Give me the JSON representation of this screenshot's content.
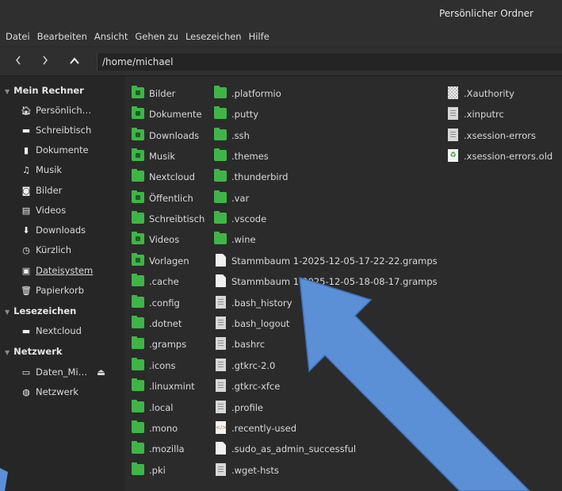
{
  "window": {
    "title": "Persönlicher Ordner"
  },
  "menu": [
    "Datei",
    "Bearbeiten",
    "Ansicht",
    "Gehen zu",
    "Lesezeichen",
    "Hilfe"
  ],
  "toolbar": {
    "back_icon": "chevron-left-icon",
    "forward_icon": "chevron-right-icon",
    "up_icon": "chevron-up-icon",
    "path": "/home/michael"
  },
  "sidebar": {
    "sections": [
      {
        "header": "Mein Rechner",
        "items": [
          {
            "label": "Persönlich…",
            "icon": "home-icon"
          },
          {
            "label": "Schreibtisch",
            "icon": "desktop-icon"
          },
          {
            "label": "Dokumente",
            "icon": "document-icon"
          },
          {
            "label": "Musik",
            "icon": "music-icon"
          },
          {
            "label": "Bilder",
            "icon": "camera-icon"
          },
          {
            "label": "Videos",
            "icon": "film-icon"
          },
          {
            "label": "Downloads",
            "icon": "download-icon"
          },
          {
            "label": "Kürzlich",
            "icon": "clock-icon"
          },
          {
            "label": "Dateisystem",
            "icon": "drive-icon"
          },
          {
            "label": "Papierkorb",
            "icon": "trash-icon"
          }
        ]
      },
      {
        "header": "Lesezeichen",
        "items": [
          {
            "label": "Nextcloud",
            "icon": "folder-icon"
          }
        ]
      },
      {
        "header": "Netzwerk",
        "items": [
          {
            "label": "Daten_Mi…",
            "icon": "network-drive-icon",
            "eject": "eject-icon"
          },
          {
            "label": "Netzwerk",
            "icon": "globe-icon"
          }
        ]
      }
    ]
  },
  "files": {
    "col1": [
      "Bilder",
      "Dokumente",
      "Downloads",
      "Musik",
      "Nextcloud",
      "Öffentlich",
      "Schreibtisch",
      "Videos",
      "Vorlagen",
      ".cache",
      ".config",
      ".dotnet",
      ".gramps",
      ".icons",
      ".linuxmint",
      ".local",
      ".mono",
      ".mozilla",
      ".pki"
    ],
    "col2": [
      ".platformio",
      ".putty",
      ".ssh",
      ".themes",
      ".thunderbird",
      ".var",
      ".vscode",
      ".wine",
      "Stammbaum 1-2025-12-05-17-22-22.gramps",
      "Stammbaum 1-2025-12-05-18-08-17.gramps",
      ".bash_history",
      ".bash_logout",
      ".bashrc",
      ".gtkrc-2.0",
      ".gtkrc-xfce",
      ".profile",
      ".recently-used",
      ".sudo_as_admin_successful",
      ".wget-hsts"
    ],
    "col3": [
      ".Xauthority",
      ".xinputrc",
      ".xsession-errors",
      ".xsession-errors.old"
    ]
  },
  "colors": {
    "folder": "#3fb548",
    "arrow": "#5b8fd6",
    "background": "#2b2b2b"
  }
}
